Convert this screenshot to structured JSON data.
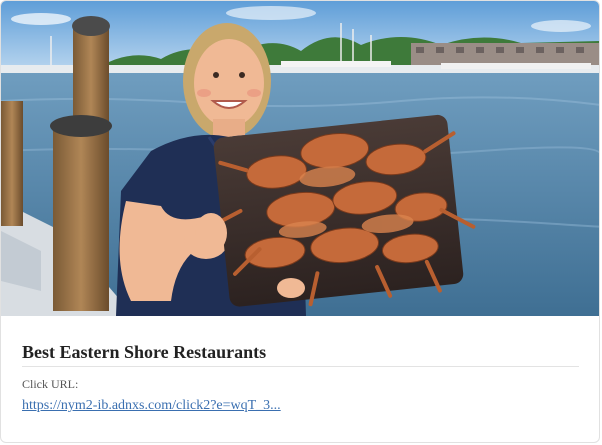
{
  "ad": {
    "image_subject": "woman holding tray of steamed crabs at marina",
    "title": "Best Eastern Shore Restaurants",
    "click_label": "Click URL:",
    "click_url": "https://nym2-ib.adnxs.com/click2?e=wqT_3..."
  },
  "colors": {
    "title": "#222222",
    "link": "#3a6fb0",
    "label": "#555555",
    "border": "#e1e1e1"
  }
}
